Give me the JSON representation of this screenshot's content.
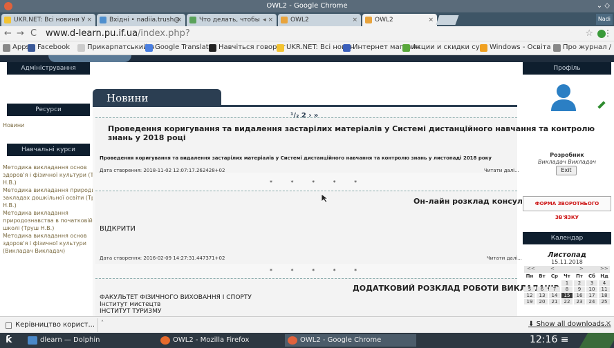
{
  "window": {
    "title": "OWL2 - Google Chrome",
    "controls": "⌄ ◇"
  },
  "tabs": [
    {
      "label": "UKR.NET: Всі новини У",
      "color": "#f3c331"
    },
    {
      "label": "Вхідні • nadiia.trush@",
      "color": "#4e8fce"
    },
    {
      "label": "Что делать, чтобы",
      "color": "#5aa25a"
    },
    {
      "label": "OWL2",
      "color": "#e8a33c"
    },
    {
      "label": "OWL2",
      "color": "#e8a33c"
    }
  ],
  "profile_name": "Nadi",
  "address": {
    "host": "www.d-learn.pu.if.ua",
    "path": "/index.php?"
  },
  "bookmarks": [
    {
      "label": "Apps",
      "color": "#888888"
    },
    {
      "label": "Facebook",
      "color": "#3b5998"
    },
    {
      "label": "Прикарпатський н",
      "color": "#cccccc"
    },
    {
      "label": "Google Translate",
      "color": "#4a7fe0"
    },
    {
      "label": "Навчіться говорит",
      "color": "#222222"
    },
    {
      "label": "UKR.NET: Всі новин",
      "color": "#f3c331"
    },
    {
      "label": "Интернет магазин",
      "color": "#3b5fbb"
    },
    {
      "label": "Акции и скидки су",
      "color": "#59a73b"
    },
    {
      "label": "Windows - Освіта М",
      "color": "#f0a020"
    },
    {
      "label": "Про журнал / Inter",
      "color": "#888888"
    }
  ],
  "left": {
    "admin_head": "Адміністрування",
    "resources_head": "Ресурси",
    "resources_link": "Новини",
    "courses_head": "Навчальні курси",
    "courses": [
      "Методика викладання основ",
      "здоров'я і фізичної культури (Труш",
      "Н.В.)",
      "Методика викладання природи в",
      "закладах дошкільної освіти (Труш",
      "Н.В.)",
      "Методика викладання",
      "природознавства в початковій",
      "школі (Труш Н.В.)",
      "Методика викладання основ",
      "здоров'я і фізичної культури",
      "(Викладач Викладач)"
    ]
  },
  "center": {
    "heading": "Новини",
    "pager": "¹/₂  2  ›  »",
    "news": [
      {
        "title": "Проведення коригування та видалення застарілих матеріалів у Системі дистанційного навчання та контролю знань у 2018 році",
        "body": "Проведення коригування та видалення застарілих матеріалів у Системі дистанційного навчання та контролю знань у листопаді 2018 року",
        "date": "Дата створення: 2018-11-02 12:07:17.262428+02",
        "more": "Читати далі..."
      },
      {
        "title": "Он-лайн розклад консультацій",
        "body": "ВІДКРИТИ",
        "date": "Дата створення: 2016-02-09 14:27:31.447371+02",
        "more": "Читати далі..."
      },
      {
        "title": "ДОДАТКОВИЙ РОЗКЛАД РОБОТИ ВИКЛАДАЧІВ",
        "lines": [
          "ФАКУЛЬТЕТ ФІЗИЧНОГО ВИХОВАННЯ І СПОРТУ",
          "Інститут мистецтв",
          "ІНСТИТУТ ТУРИЗМУ"
        ]
      }
    ],
    "stars": "* * * * *"
  },
  "right": {
    "profile_head": "Профіль",
    "developer": "Розробник",
    "developer_sub": "Викладач  Викладач",
    "exit": "Exit",
    "feedback": "ФОРМА ЗВОРОТНЬОГО ЗВ'ЯЗКУ",
    "calendar_head": "Календар",
    "month": "Листопад",
    "date": "15.11.2018",
    "nav": [
      "<<",
      "<",
      ">",
      ">>"
    ],
    "weekdays": [
      "Пн",
      "Вт",
      "Ср",
      "Чт",
      "Пт",
      "Сб",
      "Нд"
    ],
    "weeks": [
      [
        "",
        "",
        "",
        "1",
        "2",
        "3",
        "4"
      ],
      [
        "5",
        "6",
        "7",
        "8",
        "9",
        "10",
        "11"
      ],
      [
        "12",
        "13",
        "14",
        "15",
        "16",
        "17",
        "18"
      ],
      [
        "19",
        "20",
        "21",
        "22",
        "23",
        "24",
        "25"
      ]
    ],
    "today": "15"
  },
  "downloads": {
    "item": "Керівництво корист...",
    "show_all": "Show all downloads...",
    "close": "×"
  },
  "taskbar": {
    "items": [
      {
        "label": "dlearn — Dolphin",
        "color": "#4a88c8"
      },
      {
        "label": "OWL2 - Mozilla Firefox",
        "color": "#e66a2c"
      },
      {
        "label": "OWL2 - Google Chrome",
        "color": "#e0623c"
      }
    ],
    "clock": "12:16 ≡"
  }
}
